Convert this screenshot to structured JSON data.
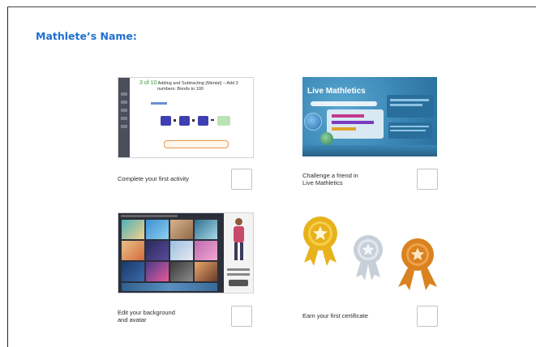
{
  "page": {
    "title": "Mathlete’s Name:"
  },
  "tasks": [
    {
      "label_line1": "Complete your first activity",
      "label_line2": ""
    },
    {
      "label_line1": "Challenge a friend in",
      "label_line2": "Live Mathletics"
    },
    {
      "label_line1": "Edit your background",
      "label_line2": "and avatar"
    },
    {
      "label_line1": "Earn your first certificate",
      "label_line2": ""
    }
  ],
  "activity_screen": {
    "progress": "3 of 10",
    "title_line1": "Adding and Subtracting (Mental) – Add 3",
    "title_line2": "numbers: Bonds to 100",
    "colors": {
      "accent": "#3d3fb2",
      "answer_box": "#b9e3b4"
    }
  },
  "live_screen": {
    "heading": "Live Mathletics",
    "colors": {
      "bg": "#3a86b5",
      "panel": "#2a6f9b"
    }
  },
  "certificates": {
    "colors": {
      "gold": "#e8b21c",
      "silver": "#c7d0d9",
      "bronze": "#d9821f"
    }
  }
}
